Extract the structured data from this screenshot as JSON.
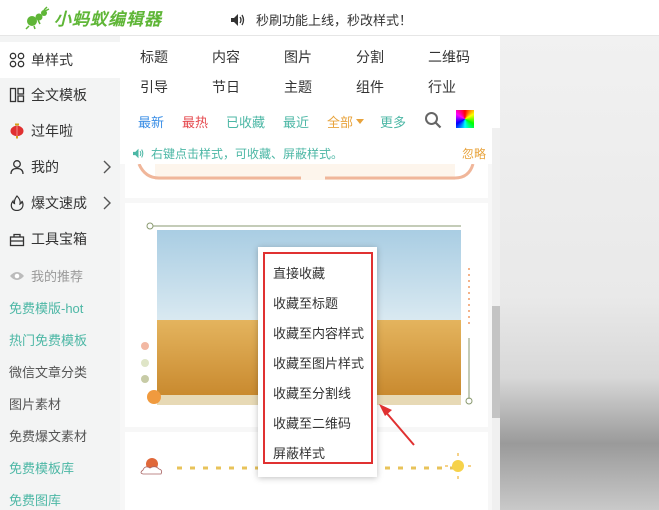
{
  "app": {
    "name": "小蚂蚁编辑器",
    "announcement": "秒刷功能上线，秒改样式！"
  },
  "sidebar": {
    "items": [
      {
        "label": "单样式",
        "icon": "grid-icon"
      },
      {
        "label": "全文模板",
        "icon": "template-icon"
      },
      {
        "label": "过年啦",
        "icon": "lantern-icon"
      },
      {
        "label": "我的",
        "icon": "user-icon"
      },
      {
        "label": "爆文速成",
        "icon": "flame-icon"
      },
      {
        "label": "工具宝箱",
        "icon": "toolbox-icon"
      }
    ],
    "recommend_label": "我的推荐",
    "links": [
      "免费模版-hot",
      "热门免费模板",
      "微信文章分类",
      "图片素材",
      "免费爆文素材",
      "免费模板库",
      "免费图库"
    ]
  },
  "categories": {
    "row1": [
      "标题",
      "内容",
      "图片",
      "分割",
      "二维码"
    ],
    "row2": [
      "引导",
      "节日",
      "主题",
      "组件",
      "行业"
    ]
  },
  "filters": {
    "items": [
      "最新",
      "最热",
      "已收藏",
      "最近",
      "全部",
      "更多"
    ],
    "colors": [
      "#3a8ee6",
      "#e5484d",
      "#4cb7a5",
      "#4cb7a5",
      "#e8a33c",
      "#4cb7a5"
    ]
  },
  "tip": {
    "text": "右键点击样式，可收藏、屏蔽样式。",
    "ignore": "忽略"
  },
  "context_menu": {
    "items": [
      "直接收藏",
      "收藏至标题",
      "收藏至内容样式",
      "收藏至图片样式",
      "收藏至分割线",
      "收藏至二维码",
      "屏蔽样式"
    ]
  },
  "colors": {
    "brand": "#5fb637",
    "accent": "#4cb7a5",
    "highlight": "#e03131"
  }
}
